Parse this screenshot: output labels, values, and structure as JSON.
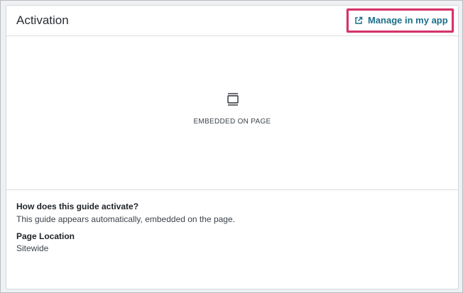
{
  "card": {
    "title": "Activation",
    "manage_link": {
      "label": "Manage in my app",
      "icon": "external-link-icon"
    }
  },
  "preview": {
    "icon": "embedded-page-icon",
    "label": "EMBEDDED ON PAGE"
  },
  "details": {
    "question": "How does this guide activate?",
    "answer": "This guide appears automatically, embedded on the page.",
    "location_label": "Page Location",
    "location_value": "Sitewide"
  },
  "colors": {
    "link": "#1a6f8a",
    "highlight": "#d6336c"
  }
}
